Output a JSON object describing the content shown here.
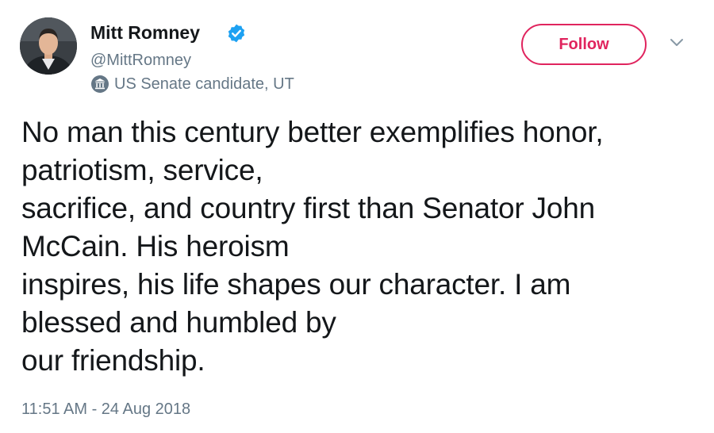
{
  "author": {
    "display_name": "Mitt Romney",
    "handle": "@MittRomney",
    "verified": true,
    "label": "US Senate candidate, UT"
  },
  "actions": {
    "follow_label": "Follow"
  },
  "tweet": {
    "lines": [
      "No man this century better exemplifies honor,",
      "patriotism, service,",
      "sacrifice, and country first than Senator John",
      "McCain. His heroism",
      "inspires, his life shapes our character. I am",
      "blessed and humbled by",
      "our friendship."
    ],
    "timestamp": "11:51 AM - 24 Aug 2018"
  },
  "colors": {
    "follow_accent": "#e0245e",
    "verified_blue": "#1da1f2",
    "secondary_text": "#657786",
    "primary_text": "#14171a"
  },
  "icons": {
    "verified": "verified-badge-icon",
    "label": "government-building-icon",
    "menu": "chevron-down-icon"
  }
}
